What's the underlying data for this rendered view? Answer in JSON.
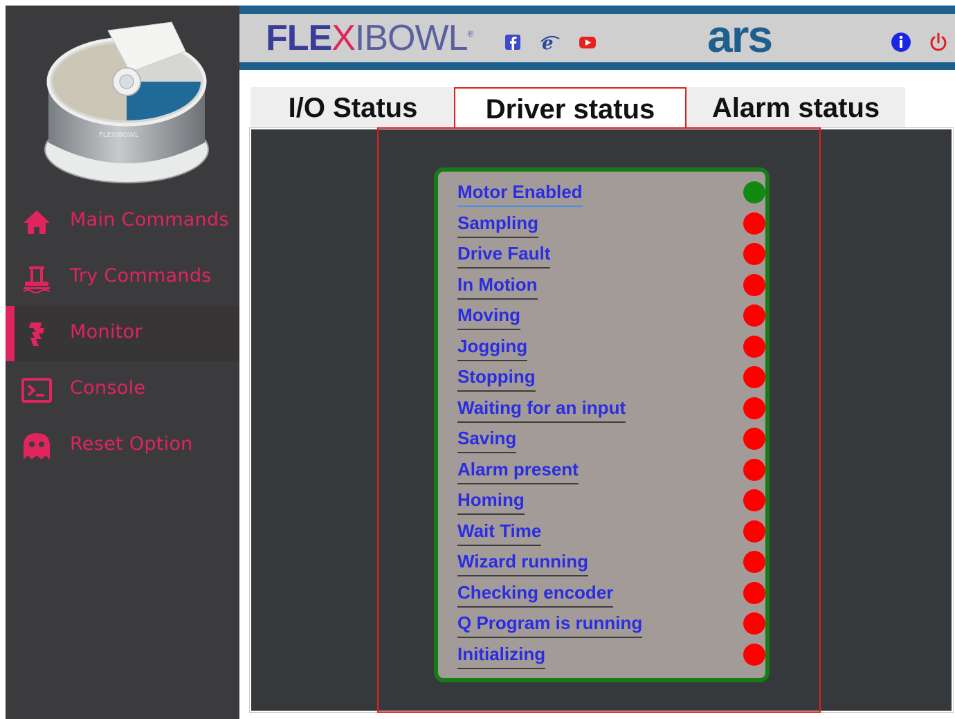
{
  "header": {
    "brand_flex": "FLE",
    "brand_x": "X",
    "brand_bowl": "IBOWL",
    "brand_reg": "®",
    "company_logo": "ars",
    "social_icons": [
      "facebook-icon",
      "internet-explorer-icon",
      "youtube-icon"
    ],
    "right_icons": [
      "info-icon",
      "power-icon"
    ],
    "colors": {
      "brand_blue": "#1e5f8e",
      "band_gray": "#cfcfcf",
      "flex_text": "#3a3d98"
    }
  },
  "sidebar": {
    "items": [
      {
        "label": "Main Commands",
        "icon": "home-icon",
        "active": false
      },
      {
        "label": "Try Commands",
        "icon": "try-commands-icon",
        "active": false
      },
      {
        "label": "Monitor",
        "icon": "monitor-icon",
        "active": true
      },
      {
        "label": "Console",
        "icon": "console-icon",
        "active": false
      },
      {
        "label": "Reset Option",
        "icon": "ghost-icon",
        "active": false
      }
    ],
    "accent": "#e0245e",
    "background": "#3b3a3c"
  },
  "tabs": [
    {
      "label": "I/O Status",
      "active": false
    },
    {
      "label": "Driver status",
      "active": true
    },
    {
      "label": "Alarm status",
      "active": false
    }
  ],
  "driver_status": {
    "items": [
      {
        "label": "Motor Enabled",
        "state": "on"
      },
      {
        "label": "Sampling",
        "state": "off"
      },
      {
        "label": "Drive Fault",
        "state": "off"
      },
      {
        "label": "In Motion",
        "state": "off"
      },
      {
        "label": "Moving",
        "state": "off"
      },
      {
        "label": "Jogging",
        "state": "off"
      },
      {
        "label": "Stopping",
        "state": "off"
      },
      {
        "label": "Waiting for an input",
        "state": "off"
      },
      {
        "label": "Saving",
        "state": "off"
      },
      {
        "label": "Alarm present",
        "state": "off"
      },
      {
        "label": "Homing",
        "state": "off"
      },
      {
        "label": "Wait Time",
        "state": "off"
      },
      {
        "label": "Wizard running",
        "state": "off"
      },
      {
        "label": "Checking encoder",
        "state": "off"
      },
      {
        "label": "Q Program is running",
        "state": "off"
      },
      {
        "label": "Initializing",
        "state": "off"
      }
    ],
    "colors": {
      "on": "#128a12",
      "off": "#ff0000",
      "card_border": "#167a16",
      "card_bg": "#a39b98",
      "label": "#2a2de0"
    }
  }
}
